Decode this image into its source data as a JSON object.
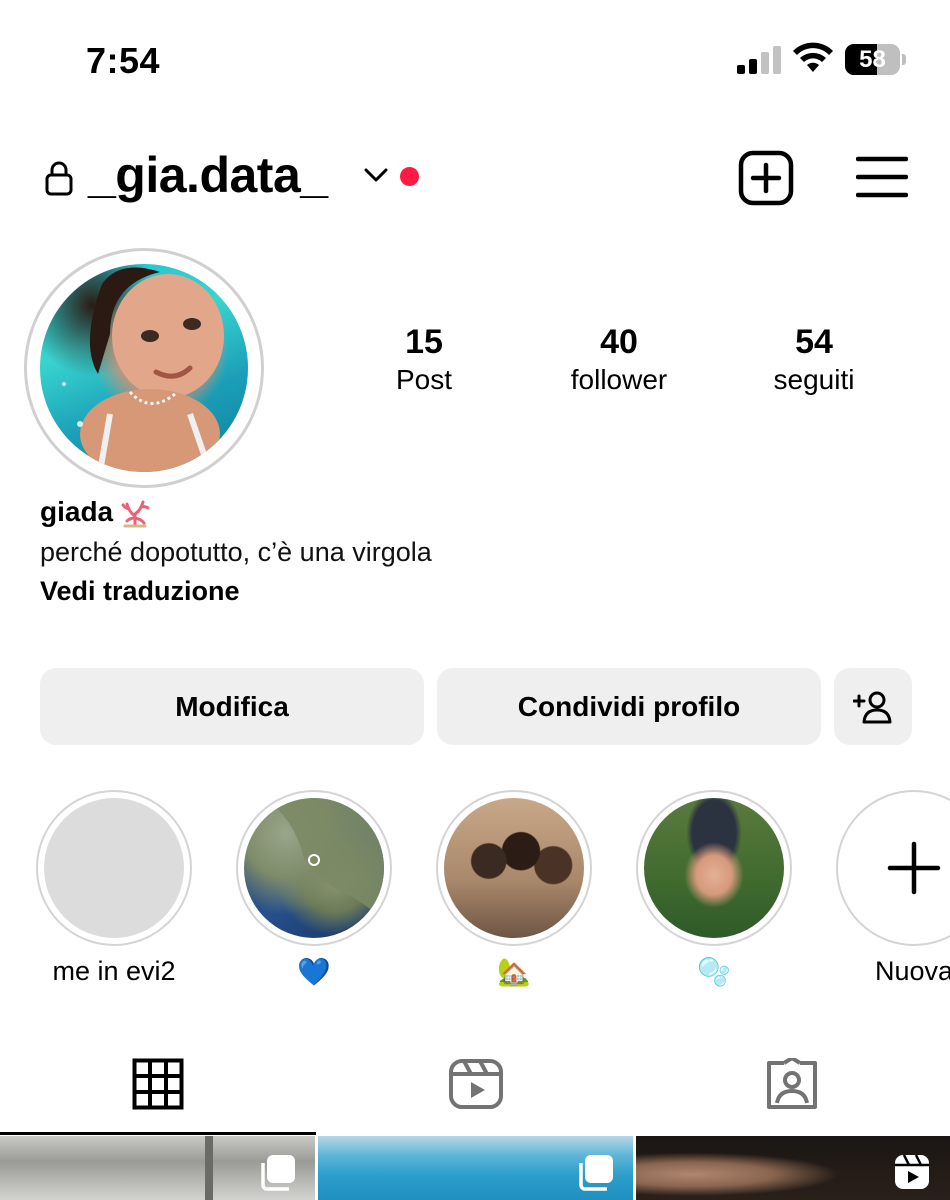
{
  "status_bar": {
    "time": "7:54",
    "battery_level": "58",
    "battery_fraction": 0.58
  },
  "header": {
    "username": "_gia.data_",
    "notification_dot_color": "#ff1a44"
  },
  "profile": {
    "stats": [
      {
        "value": "15",
        "label": "Post"
      },
      {
        "value": "40",
        "label": "follower"
      },
      {
        "value": "54",
        "label": "seguiti"
      }
    ],
    "name": "giada",
    "name_emoji_icon": "coral-icon",
    "bio": "perché dopotutto, c’è una virgola",
    "translate_label": "Vedi traduzione"
  },
  "actions": {
    "edit_label": "Modifica",
    "share_label": "Condividi profilo",
    "add_person_icon": "person-add-icon"
  },
  "highlights": [
    {
      "label": "me in evi2"
    },
    {
      "label": "💙"
    },
    {
      "label": "🏡"
    },
    {
      "label": "🫧"
    },
    {
      "label": "Nuova"
    }
  ],
  "tabs": [
    {
      "icon": "grid-icon",
      "selected": true
    },
    {
      "icon": "reels-icon",
      "selected": false
    },
    {
      "icon": "tagged-icon",
      "selected": false
    }
  ],
  "grid_posts": [
    {
      "badge_icon": "carousel-icon"
    },
    {
      "badge_icon": "carousel-icon"
    },
    {
      "badge_icon": "reel-icon"
    }
  ]
}
